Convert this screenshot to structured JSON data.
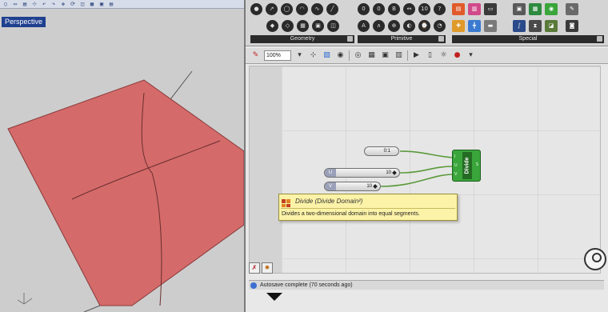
{
  "rhino": {
    "viewport_title": "Perspective",
    "toolbar_icons": [
      "○",
      "▭",
      "▤",
      "⊹",
      "↶",
      "↷",
      "✥",
      "⟳",
      "◫",
      "▦",
      "▣",
      "▤"
    ]
  },
  "ribbon": {
    "geometry_label": "Geometry",
    "primitive_label": "Primitive",
    "special_label": "Special"
  },
  "toolbar": {
    "zoom": "100%"
  },
  "canvas": {
    "domain_param": "0:1",
    "slider_u": {
      "tag": "U",
      "value": "10"
    },
    "slider_v": {
      "tag": "V",
      "value": "10"
    },
    "component_name": "Divide",
    "in_ports": [
      "I",
      "U",
      "V"
    ],
    "out_port": "S"
  },
  "tooltip": {
    "title": "Divide (Divide Domain²)",
    "description": "Divides a two-dimensional domain into equal segments."
  },
  "status": {
    "text": "Autosave complete (70 seconds ago)"
  },
  "colors": {
    "surface_fill": "#d46a6a",
    "component_green": "#3aa53a",
    "tooltip_bg": "#fdf3a8",
    "viewport_title_bg": "#1f3f8f"
  }
}
